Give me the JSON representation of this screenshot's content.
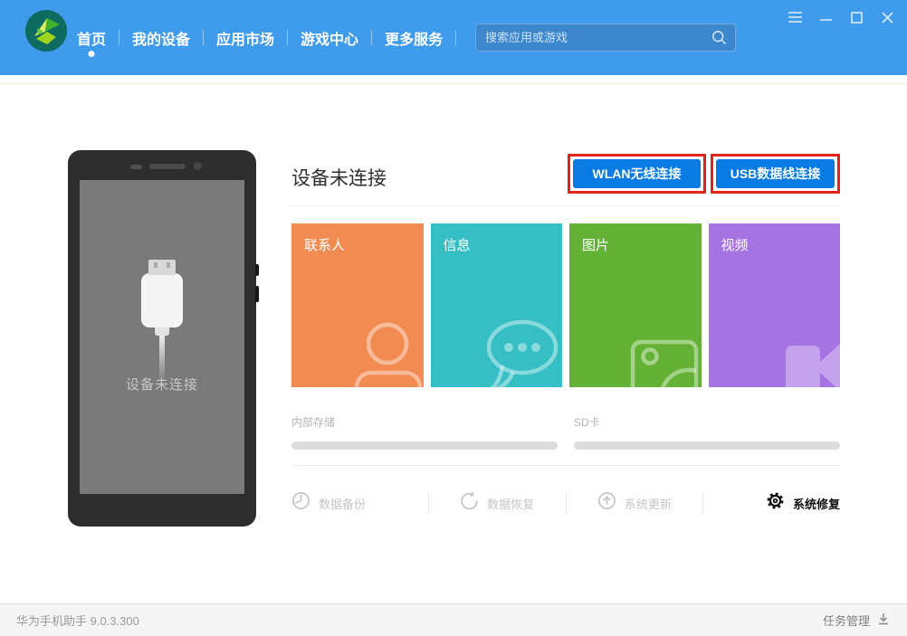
{
  "header": {
    "nav_items": [
      {
        "label": "首页",
        "active": true
      },
      {
        "label": "我的设备",
        "active": false
      },
      {
        "label": "应用市场",
        "active": false
      },
      {
        "label": "游戏中心",
        "active": false
      },
      {
        "label": "更多服务",
        "active": false
      }
    ],
    "search": {
      "placeholder": "搜索应用或游戏"
    }
  },
  "device_preview": {
    "status_text": "设备未连接"
  },
  "main": {
    "heading": "设备未连接",
    "connect_buttons": [
      {
        "label": "WLAN无线连接"
      },
      {
        "label": "USB数据线连接"
      }
    ],
    "tiles": [
      {
        "label": "联系人",
        "color": "#F18B52",
        "icon": "contacts-icon"
      },
      {
        "label": "信息",
        "color": "#35BFC4",
        "icon": "messages-icon"
      },
      {
        "label": "图片",
        "color": "#64B235",
        "icon": "pictures-icon"
      },
      {
        "label": "视频",
        "color": "#A673E2",
        "icon": "videos-icon"
      }
    ],
    "storage": [
      {
        "label": "内部存储"
      },
      {
        "label": "SD卡"
      }
    ],
    "actions": [
      {
        "label": "数据备份",
        "enabled": false,
        "icon": "backup-clock-icon"
      },
      {
        "label": "数据恢复",
        "enabled": false,
        "icon": "restore-arrow-icon"
      },
      {
        "label": "系统更新",
        "enabled": false,
        "icon": "update-arrow-icon"
      },
      {
        "label": "系统修复",
        "enabled": true,
        "icon": "repair-gear-icon"
      }
    ]
  },
  "footer": {
    "app_name_version": "华为手机助手 9.0.3.300",
    "task_manager_label": "任务管理"
  },
  "colors": {
    "header_blue": "#3F9BEC",
    "search_fill_blue": "#3C86CE",
    "button_blue": "#0B7BE4",
    "annotation_red": "#E1251B",
    "tile_orange": "#F18B52",
    "tile_teal": "#35BFC4",
    "tile_green": "#64B235",
    "tile_purple": "#A673E2",
    "phone_body": "#2D2D2D",
    "phone_screen": "#7A7A7A",
    "progress_gray": "#DCDCDC"
  }
}
